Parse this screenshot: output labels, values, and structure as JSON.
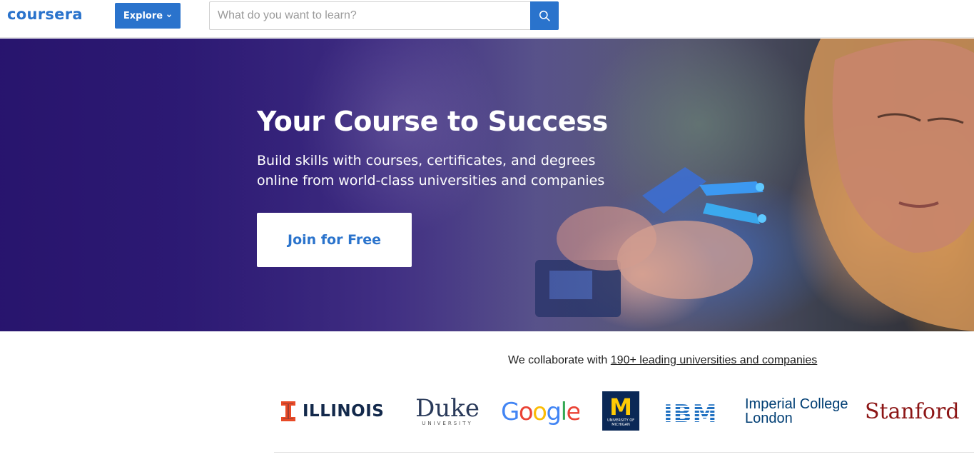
{
  "header": {
    "logo_text": "coursera",
    "explore_label": "Explore",
    "search_placeholder": "What do you want to learn?"
  },
  "hero": {
    "title": "Your Course to Success",
    "subtitle_line1": "Build skills with courses, certificates, and degrees",
    "subtitle_line2": "online from world-class universities and companies",
    "cta_label": "Join for Free"
  },
  "partners": {
    "intro_text": "We collaborate with ",
    "link_text": "190+ leading universities and companies",
    "logos": [
      {
        "name": "ILLINOIS"
      },
      {
        "name": "Duke",
        "sub": "UNIVERSITY"
      },
      {
        "name": "Google"
      },
      {
        "name": "M",
        "sub": "UNIVERSITY OF MICHIGAN"
      },
      {
        "name": "IBM"
      },
      {
        "name_line1": "Imperial College",
        "name_line2": "London"
      },
      {
        "name": "Stanford"
      }
    ]
  },
  "colors": {
    "brand_blue": "#2a73cc",
    "hero_purple": "#2a1a6b",
    "illinois_orange": "#e84a27",
    "michigan_navy": "#0a2856",
    "michigan_maize": "#ffcb05",
    "stanford_red": "#8c1515"
  }
}
